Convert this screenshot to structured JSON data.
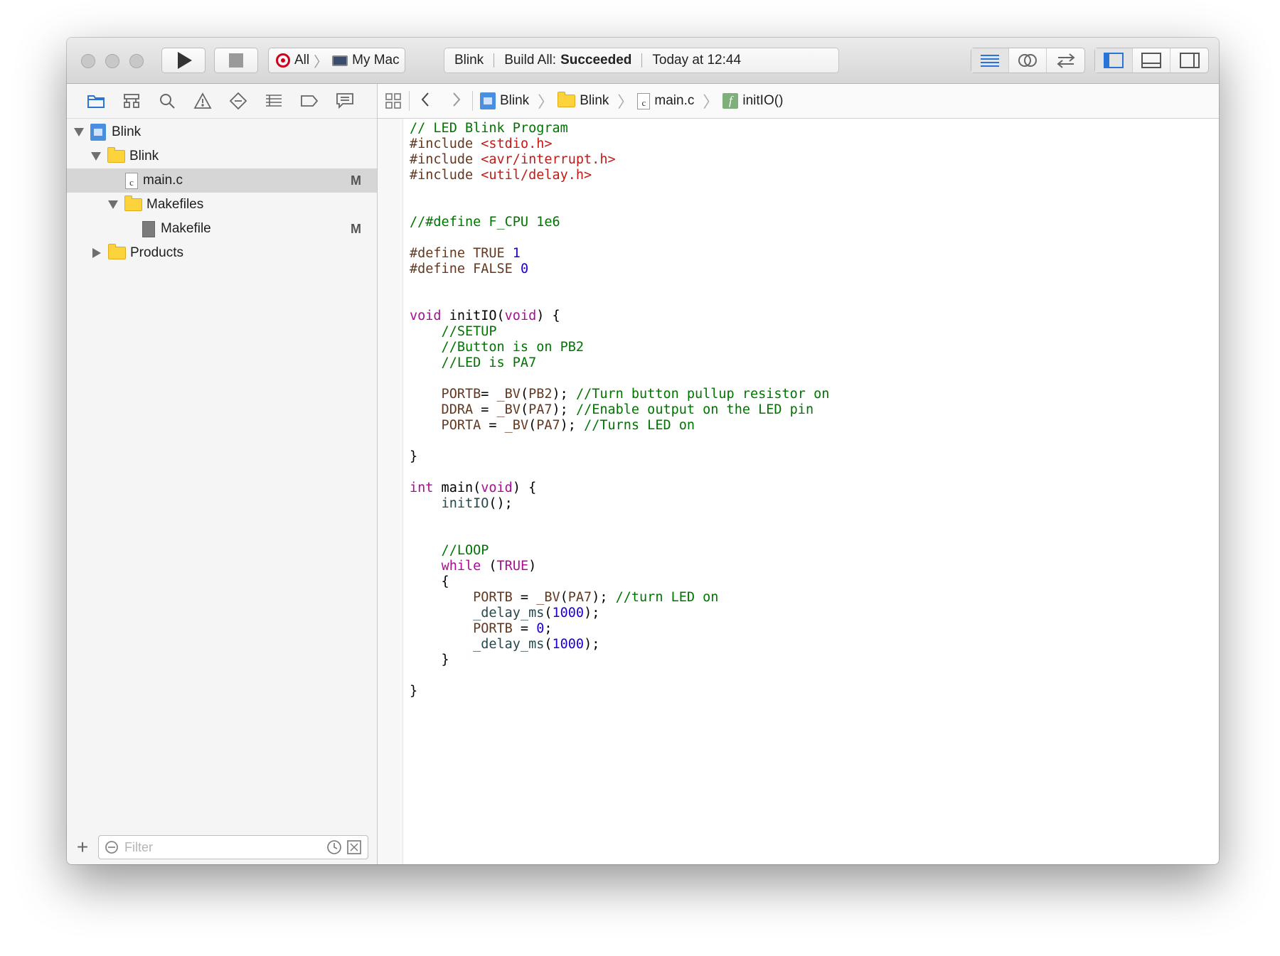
{
  "toolbar": {
    "scheme_all": "All",
    "scheme_device": "My Mac",
    "activity_project": "Blink",
    "activity_build_prefix": "Build All:",
    "activity_build_status": "Succeeded",
    "activity_time": "Today at 12:44"
  },
  "navigator": {
    "tree": {
      "project": "Blink",
      "group": "Blink",
      "file_main": "main.c",
      "file_main_badge": "M",
      "folder_makefiles": "Makefiles",
      "file_makefile": "Makefile",
      "file_makefile_badge": "M",
      "folder_products": "Products"
    },
    "filter_placeholder": "Filter"
  },
  "jumpbar": {
    "crumbs": [
      "Blink",
      "Blink",
      "main.c",
      "initIO()"
    ]
  },
  "colors": {
    "comment": "#007400",
    "string": "#c41a16",
    "keyword": "#aa0d91",
    "number": "#1c00cf",
    "macro": "#643820",
    "function": "#26474b",
    "plain": "#000000"
  },
  "code_lines": [
    [
      [
        "// LED Blink Program",
        "comment"
      ]
    ],
    [
      [
        "#include ",
        "macro"
      ],
      [
        "<stdio.h>",
        "string"
      ]
    ],
    [
      [
        "#include ",
        "macro"
      ],
      [
        "<avr/interrupt.h>",
        "string"
      ]
    ],
    [
      [
        "#include ",
        "macro"
      ],
      [
        "<util/delay.h>",
        "string"
      ]
    ],
    [],
    [],
    [
      [
        "//#define F_CPU 1e6",
        "comment"
      ]
    ],
    [],
    [
      [
        "#define TRUE ",
        "macro"
      ],
      [
        "1",
        "number"
      ]
    ],
    [
      [
        "#define FALSE ",
        "macro"
      ],
      [
        "0",
        "number"
      ]
    ],
    [],
    [],
    [
      [
        "void",
        "keyword"
      ],
      [
        " initIO(",
        "plain"
      ],
      [
        "void",
        "keyword"
      ],
      [
        ") {",
        "plain"
      ]
    ],
    [
      [
        "    //SETUP",
        "comment"
      ]
    ],
    [
      [
        "    //Button is on PB2",
        "comment"
      ]
    ],
    [
      [
        "    //LED is PA7",
        "comment"
      ]
    ],
    [],
    [
      [
        "    PORTB",
        "macro"
      ],
      [
        "= ",
        "plain"
      ],
      [
        "_BV",
        "macro"
      ],
      [
        "(",
        "plain"
      ],
      [
        "PB2",
        "macro"
      ],
      [
        "); ",
        "plain"
      ],
      [
        "//Turn button pullup resistor on",
        "comment"
      ]
    ],
    [
      [
        "    DDRA",
        "macro"
      ],
      [
        " = ",
        "plain"
      ],
      [
        "_BV",
        "macro"
      ],
      [
        "(",
        "plain"
      ],
      [
        "PA7",
        "macro"
      ],
      [
        "); ",
        "plain"
      ],
      [
        "//Enable output on the LED pin",
        "comment"
      ]
    ],
    [
      [
        "    PORTA",
        "macro"
      ],
      [
        " = ",
        "plain"
      ],
      [
        "_BV",
        "macro"
      ],
      [
        "(",
        "plain"
      ],
      [
        "PA7",
        "macro"
      ],
      [
        "); ",
        "plain"
      ],
      [
        "//Turns LED on",
        "comment"
      ]
    ],
    [],
    [
      [
        "}",
        "plain"
      ]
    ],
    [],
    [
      [
        "int",
        "keyword"
      ],
      [
        " main(",
        "plain"
      ],
      [
        "void",
        "keyword"
      ],
      [
        ") {",
        "plain"
      ]
    ],
    [
      [
        "    ",
        "plain"
      ],
      [
        "initIO",
        "function"
      ],
      [
        "();",
        "plain"
      ]
    ],
    [],
    [],
    [
      [
        "    //LOOP",
        "comment"
      ]
    ],
    [
      [
        "    ",
        "plain"
      ],
      [
        "while",
        "keyword"
      ],
      [
        " (",
        "plain"
      ],
      [
        "TRUE",
        "keyword"
      ],
      [
        ")",
        "plain"
      ]
    ],
    [
      [
        "    {",
        "plain"
      ]
    ],
    [
      [
        "        PORTB",
        "macro"
      ],
      [
        " = ",
        "plain"
      ],
      [
        "_BV",
        "macro"
      ],
      [
        "(",
        "plain"
      ],
      [
        "PA7",
        "macro"
      ],
      [
        "); ",
        "plain"
      ],
      [
        "//turn LED on",
        "comment"
      ]
    ],
    [
      [
        "        ",
        "plain"
      ],
      [
        "_delay_ms",
        "function"
      ],
      [
        "(",
        "plain"
      ],
      [
        "1000",
        "number"
      ],
      [
        ");",
        "plain"
      ]
    ],
    [
      [
        "        PORTB",
        "macro"
      ],
      [
        " = ",
        "plain"
      ],
      [
        "0",
        "number"
      ],
      [
        ";",
        "plain"
      ]
    ],
    [
      [
        "        ",
        "plain"
      ],
      [
        "_delay_ms",
        "function"
      ],
      [
        "(",
        "plain"
      ],
      [
        "1000",
        "number"
      ],
      [
        ");",
        "plain"
      ]
    ],
    [
      [
        "    }",
        "plain"
      ]
    ],
    [],
    [
      [
        "}",
        "plain"
      ]
    ]
  ]
}
